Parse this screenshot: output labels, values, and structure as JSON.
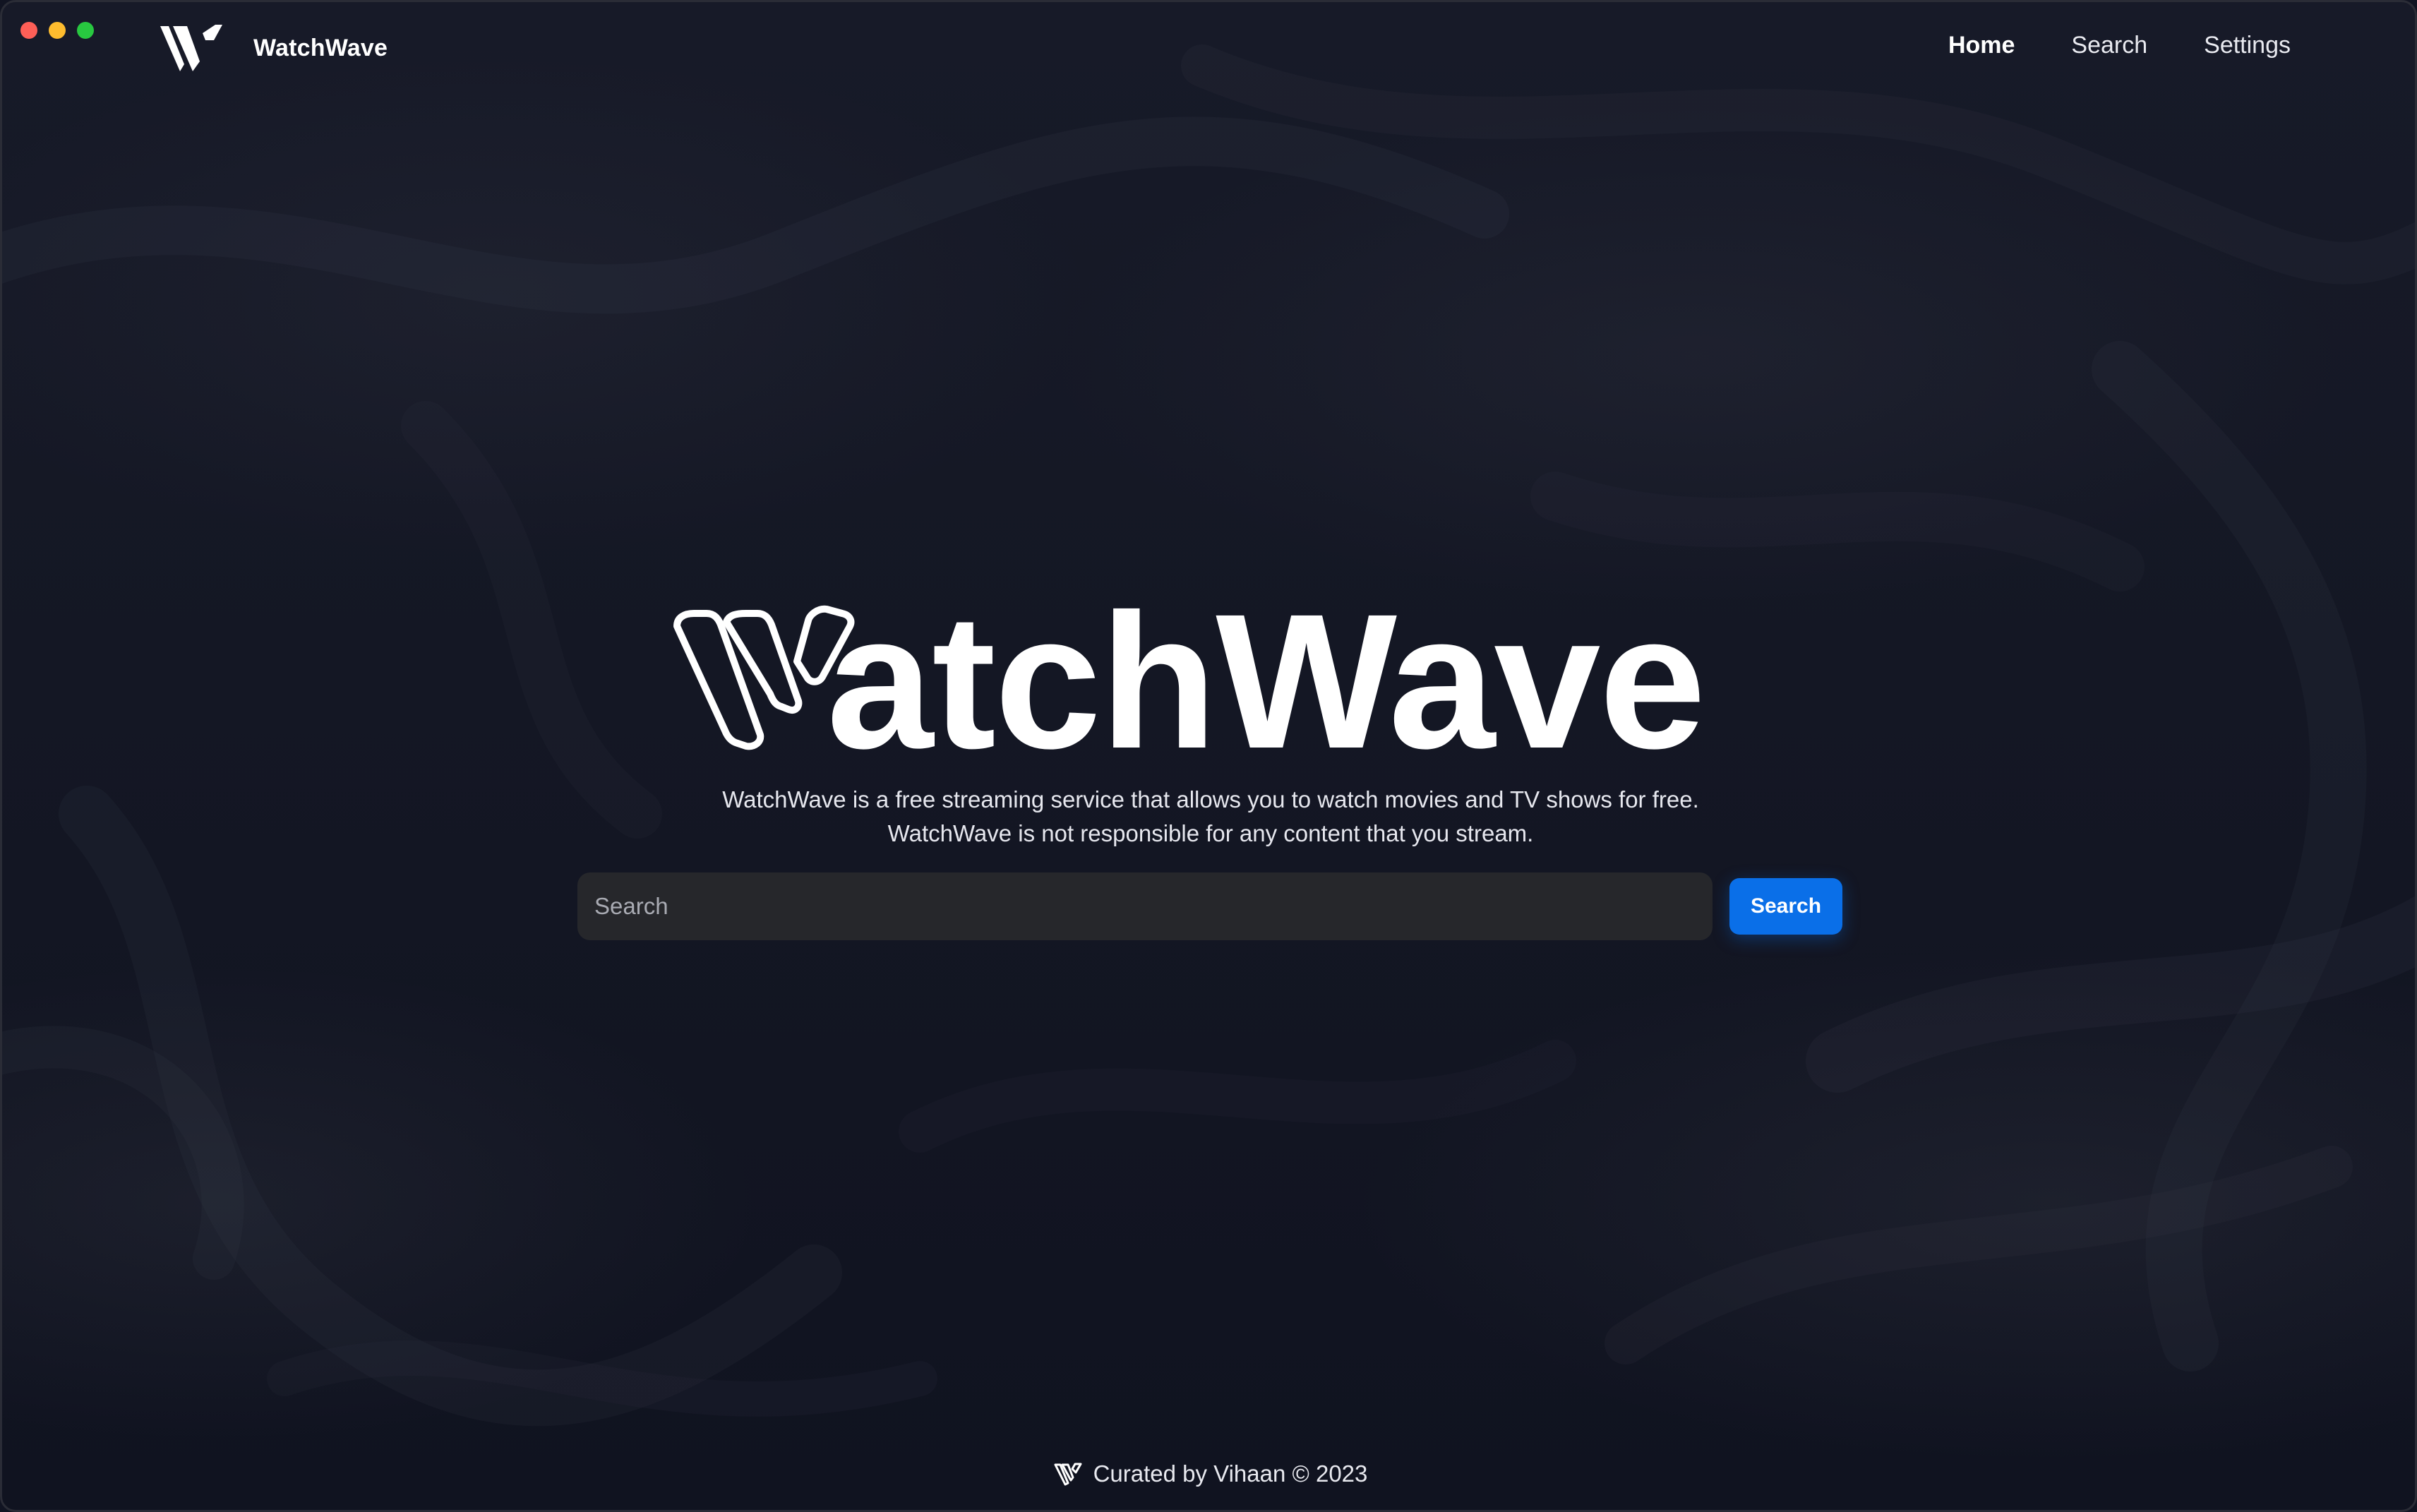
{
  "window": {
    "controls": [
      "close",
      "minimize",
      "zoom"
    ]
  },
  "header": {
    "brand_name": "WatchWave",
    "logo_icon": "watchwave-w-logo",
    "nav": [
      {
        "label": "Home",
        "active": true
      },
      {
        "label": "Search",
        "active": false
      },
      {
        "label": "Settings",
        "active": false
      }
    ]
  },
  "hero": {
    "title_suffix": "atchWave",
    "logo_icon": "watchwave-outline-w-logo",
    "tagline_line1": "WatchWave is a free streaming service that allows you to watch movies and TV shows for free.",
    "tagline_line2": "WatchWave is not responsible for any content that you stream."
  },
  "search": {
    "placeholder": "Search",
    "value": "",
    "button_label": "Search"
  },
  "footer": {
    "logo_icon": "watchwave-small-logo",
    "text": "Curated by Vihaan © 2023"
  },
  "colors": {
    "background": "#141724",
    "accent": "#0a6fe8",
    "input_bg": "#26272b"
  }
}
